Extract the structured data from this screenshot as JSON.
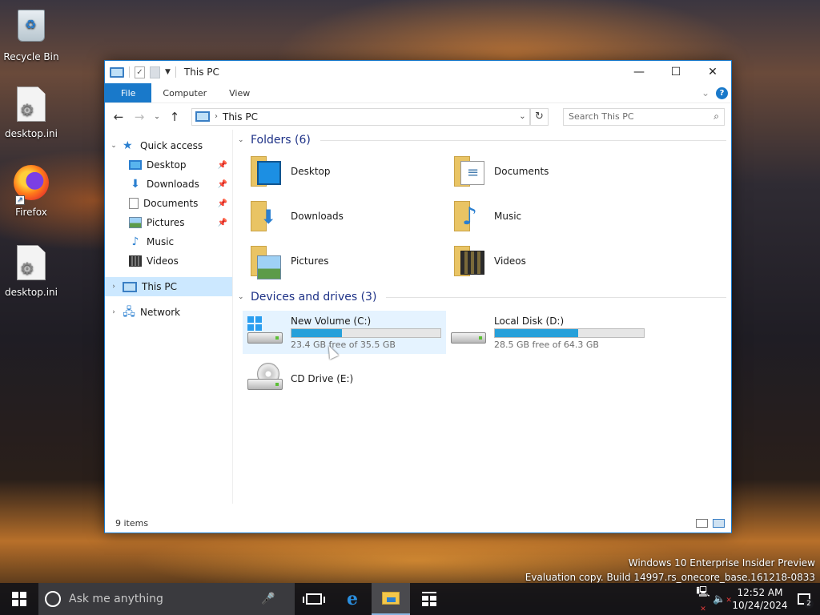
{
  "desktop": {
    "icons": [
      {
        "label": "Recycle Bin"
      },
      {
        "label": "desktop.ini"
      },
      {
        "label": "Firefox"
      },
      {
        "label": "desktop.ini"
      }
    ]
  },
  "window": {
    "title": "This PC",
    "controls": {
      "minimize": "—",
      "maximize": "☐",
      "close": "✕"
    },
    "ribbon": {
      "tabs": [
        "File",
        "Computer",
        "View"
      ]
    },
    "address": {
      "path": "This PC"
    },
    "search": {
      "placeholder": "Search This PC"
    },
    "nav_pane": {
      "quick_access": "Quick access",
      "items": [
        "Desktop",
        "Downloads",
        "Documents",
        "Pictures",
        "Music",
        "Videos"
      ],
      "this_pc": "This PC",
      "network": "Network"
    },
    "folders": {
      "heading": "Folders (6)",
      "items": [
        "Desktop",
        "Documents",
        "Downloads",
        "Music",
        "Pictures",
        "Videos"
      ]
    },
    "drives": {
      "heading": "Devices and drives (3)",
      "items": [
        {
          "name": "New Volume (C:)",
          "free": "23.4 GB free of 35.5 GB",
          "used_fraction": 0.34
        },
        {
          "name": "Local Disk (D:)",
          "free": "28.5 GB free of 64.3 GB",
          "used_fraction": 0.56
        },
        {
          "name": "CD Drive (E:)"
        }
      ]
    },
    "status": {
      "count": "9 items"
    }
  },
  "watermark": {
    "line1": "Windows 10 Enterprise Insider Preview",
    "line2": "Evaluation copy. Build 14997.rs_onecore_base.161218-0833"
  },
  "taskbar": {
    "search_placeholder": "Ask me anything",
    "clock": {
      "time": "12:52 AM",
      "date": "10/24/2024"
    },
    "notifications": "2"
  }
}
